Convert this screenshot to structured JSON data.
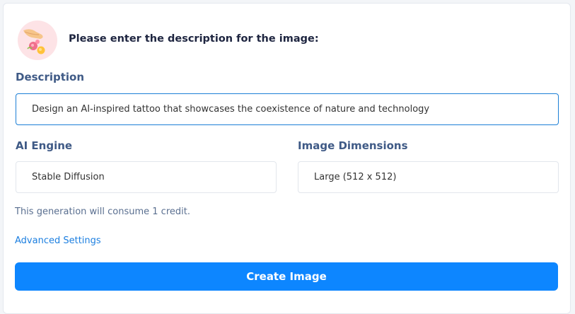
{
  "header": {
    "prompt": "Please enter the description for the image:"
  },
  "description": {
    "label": "Description",
    "value": "Design an AI-inspired tattoo that showcases the coexistence of nature and technology"
  },
  "engine": {
    "label": "AI Engine",
    "value": "Stable Diffusion"
  },
  "dimensions": {
    "label": "Image Dimensions",
    "value": "Large (512 x 512)"
  },
  "credit_note": "This generation will consume 1 credit.",
  "advanced_link": "Advanced Settings",
  "create_button": "Create Image",
  "colors": {
    "accent": "#0d86ff",
    "label": "#3f5a86",
    "focus_border": "#1c7fd6"
  }
}
